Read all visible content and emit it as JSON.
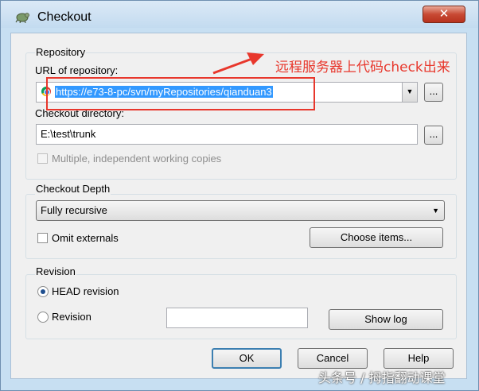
{
  "window": {
    "title": "Checkout",
    "close_label": "✕"
  },
  "repository": {
    "group_label": "Repository",
    "url_label": "URL of repository:",
    "url_value": "https://e73-8-pc/svn/myRepositories/qianduan3",
    "browse_label": "...",
    "dir_label": "Checkout directory:",
    "dir_value": "E:\\test\\trunk",
    "dir_browse_label": "...",
    "multiple_label": "Multiple, independent working copies"
  },
  "depth": {
    "group_label": "Checkout Depth",
    "selected": "Fully recursive",
    "omit_label": "Omit externals",
    "choose_label": "Choose items..."
  },
  "revision": {
    "group_label": "Revision",
    "head_label": "HEAD revision",
    "revision_label": "Revision",
    "revision_value": "",
    "showlog_label": "Show log"
  },
  "buttons": {
    "ok": "OK",
    "cancel": "Cancel",
    "help": "Help"
  },
  "annotation": {
    "text": "远程服务器上代码check出来"
  },
  "watermark": {
    "text": "头条号 / 拇指翻动课堂"
  },
  "colors": {
    "annotation": "#e8372c",
    "selection": "#3399ff",
    "titlebar": "#c7dff2"
  }
}
